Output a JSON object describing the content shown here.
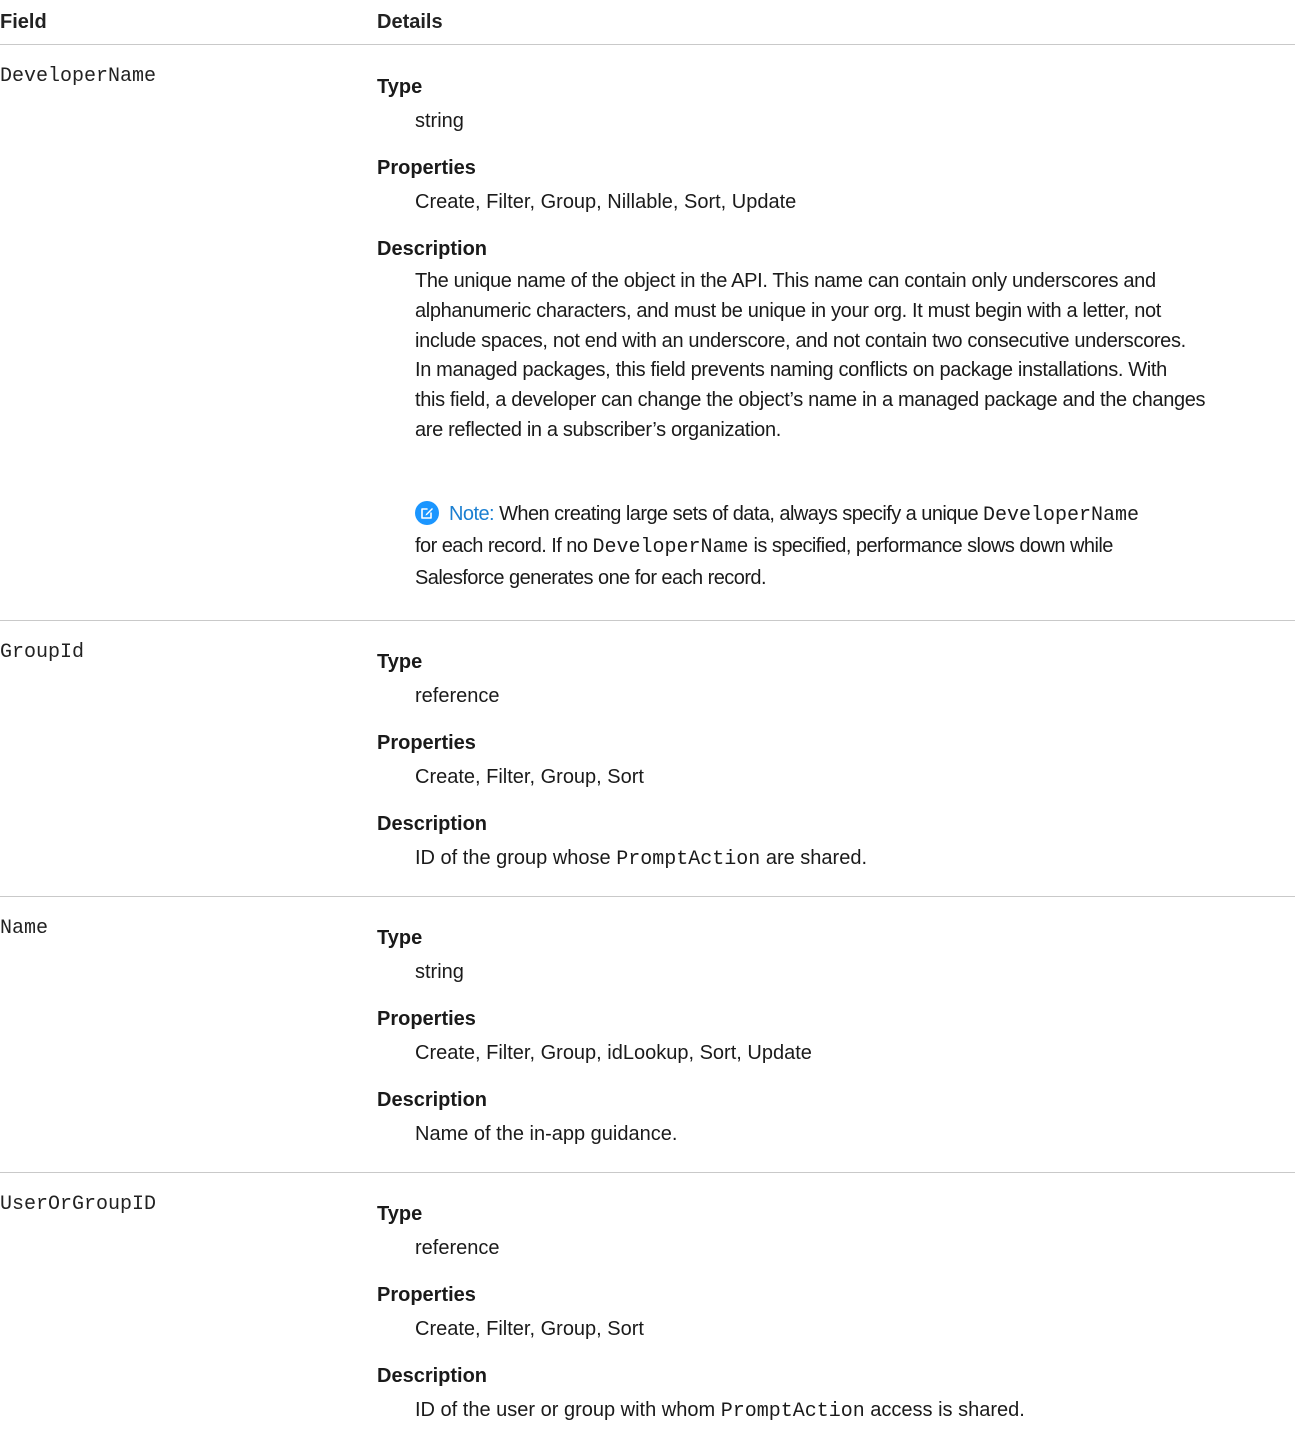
{
  "header": {
    "field": "Field",
    "details": "Details"
  },
  "rows": [
    {
      "name": "DeveloperName",
      "type_label": "Type",
      "type": "string",
      "properties_label": "Properties",
      "properties": "Create, Filter, Group, Nillable, Sort, Update",
      "description_label": "Description",
      "description_lines": [
        "The unique name of the object in the API. This name can contain only underscores and",
        "alphanumeric characters, and must be unique in your org. It must begin with a letter, not",
        "include spaces, not end with an underscore, and not contain two consecutive underscores.",
        "In managed packages, this field prevents naming conflicts on package installations. With",
        "this field, a developer can change the object’s name in a managed package and the changes",
        "are reflected in a subscriber’s organization."
      ],
      "note": {
        "label": "Note:",
        "line1_a": "When creating large sets of data, always specify a unique",
        "line1_code": "DeveloperName",
        "line2_a": "for each record. If no",
        "line2_code": "DeveloperName",
        "line2_b": "is specified, performance slows down while",
        "line3": "Salesforce generates one for each record."
      }
    },
    {
      "name": "GroupId",
      "type_label": "Type",
      "type": "reference",
      "properties_label": "Properties",
      "properties": "Create, Filter, Group, Sort",
      "description_label": "Description",
      "desc_a": "ID of the group whose",
      "desc_code": "PromptAction",
      "desc_b": "are shared."
    },
    {
      "name": "Name",
      "type_label": "Type",
      "type": "string",
      "properties_label": "Properties",
      "properties": "Create, Filter, Group, idLookup, Sort, Update",
      "description_label": "Description",
      "desc": "Name of the in-app guidance."
    },
    {
      "name": "UserOrGroupID",
      "type_label": "Type",
      "type": "reference",
      "properties_label": "Properties",
      "properties": "Create, Filter, Group, Sort",
      "description_label": "Description",
      "desc_a": "ID of the user or group with whom",
      "desc_code": "PromptAction",
      "desc_b": "access is shared."
    }
  ],
  "colors": {
    "note_icon": "#1b96ff",
    "note_label": "#1b7fd1",
    "divider": "#c9c9c9"
  }
}
